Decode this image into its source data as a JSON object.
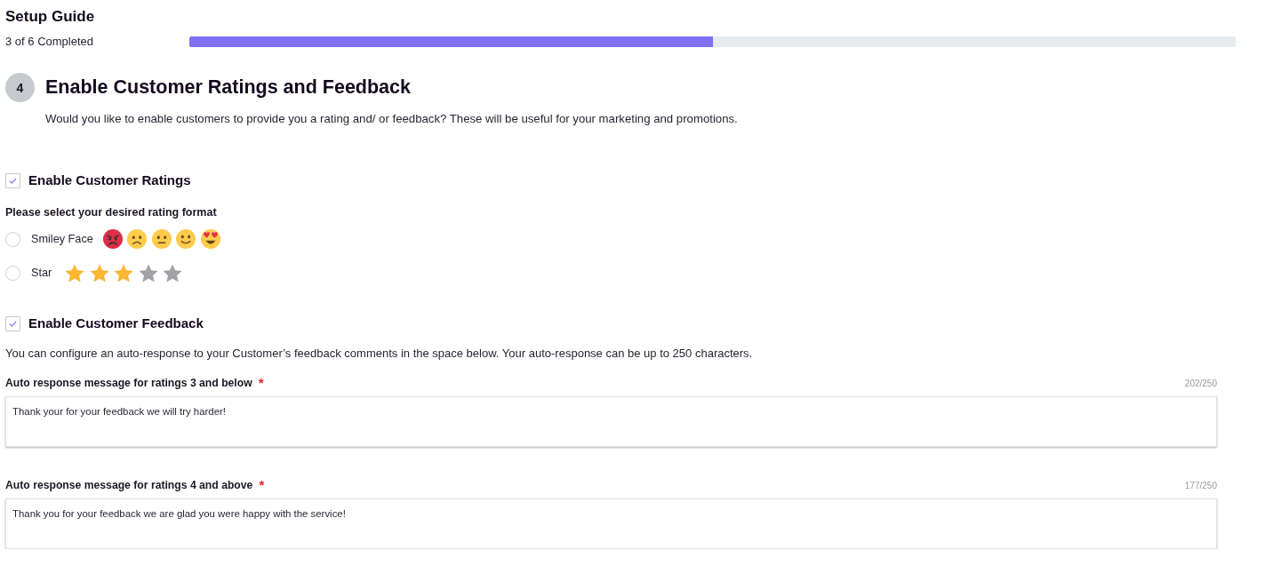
{
  "header": {
    "title": "Setup Guide",
    "progress_text": "3 of 6 Completed",
    "progress": {
      "level": 0.5
    }
  },
  "step": {
    "number": "4",
    "title": "Enable Customer Ratings and Feedback",
    "description": "Would you like to enable customers to provide you a rating and/ or feedback? These will be useful for your marketing and promotions."
  },
  "ratings": {
    "checkbox": {
      "label": "Enable Customer Ratings",
      "checked": true
    },
    "format_prompt": "Please select your desired rating format",
    "options": [
      {
        "kind": "smiley",
        "label": "Smiley Face",
        "selected": false
      },
      {
        "kind": "star",
        "label": "Star",
        "selected": false,
        "stars": 3
      }
    ]
  },
  "feedback": {
    "checkbox": {
      "label": "Enable Customer Feedback",
      "checked": true
    },
    "description": "You can configure an auto-response to your Customer’s feedback comments in the space below. Your auto-response can be up to 250 characters.",
    "fields": [
      {
        "label": "Auto response message for ratings 3 and below",
        "required_mark": "*",
        "counter": "202/250",
        "value": "Thank your for your feedback we will try harder!"
      },
      {
        "label": "Auto response message for ratings 4 and above",
        "required_mark": "*",
        "counter": "177/250",
        "value": "Thank you for your feedback we are glad you were happy with the service!"
      }
    ]
  }
}
